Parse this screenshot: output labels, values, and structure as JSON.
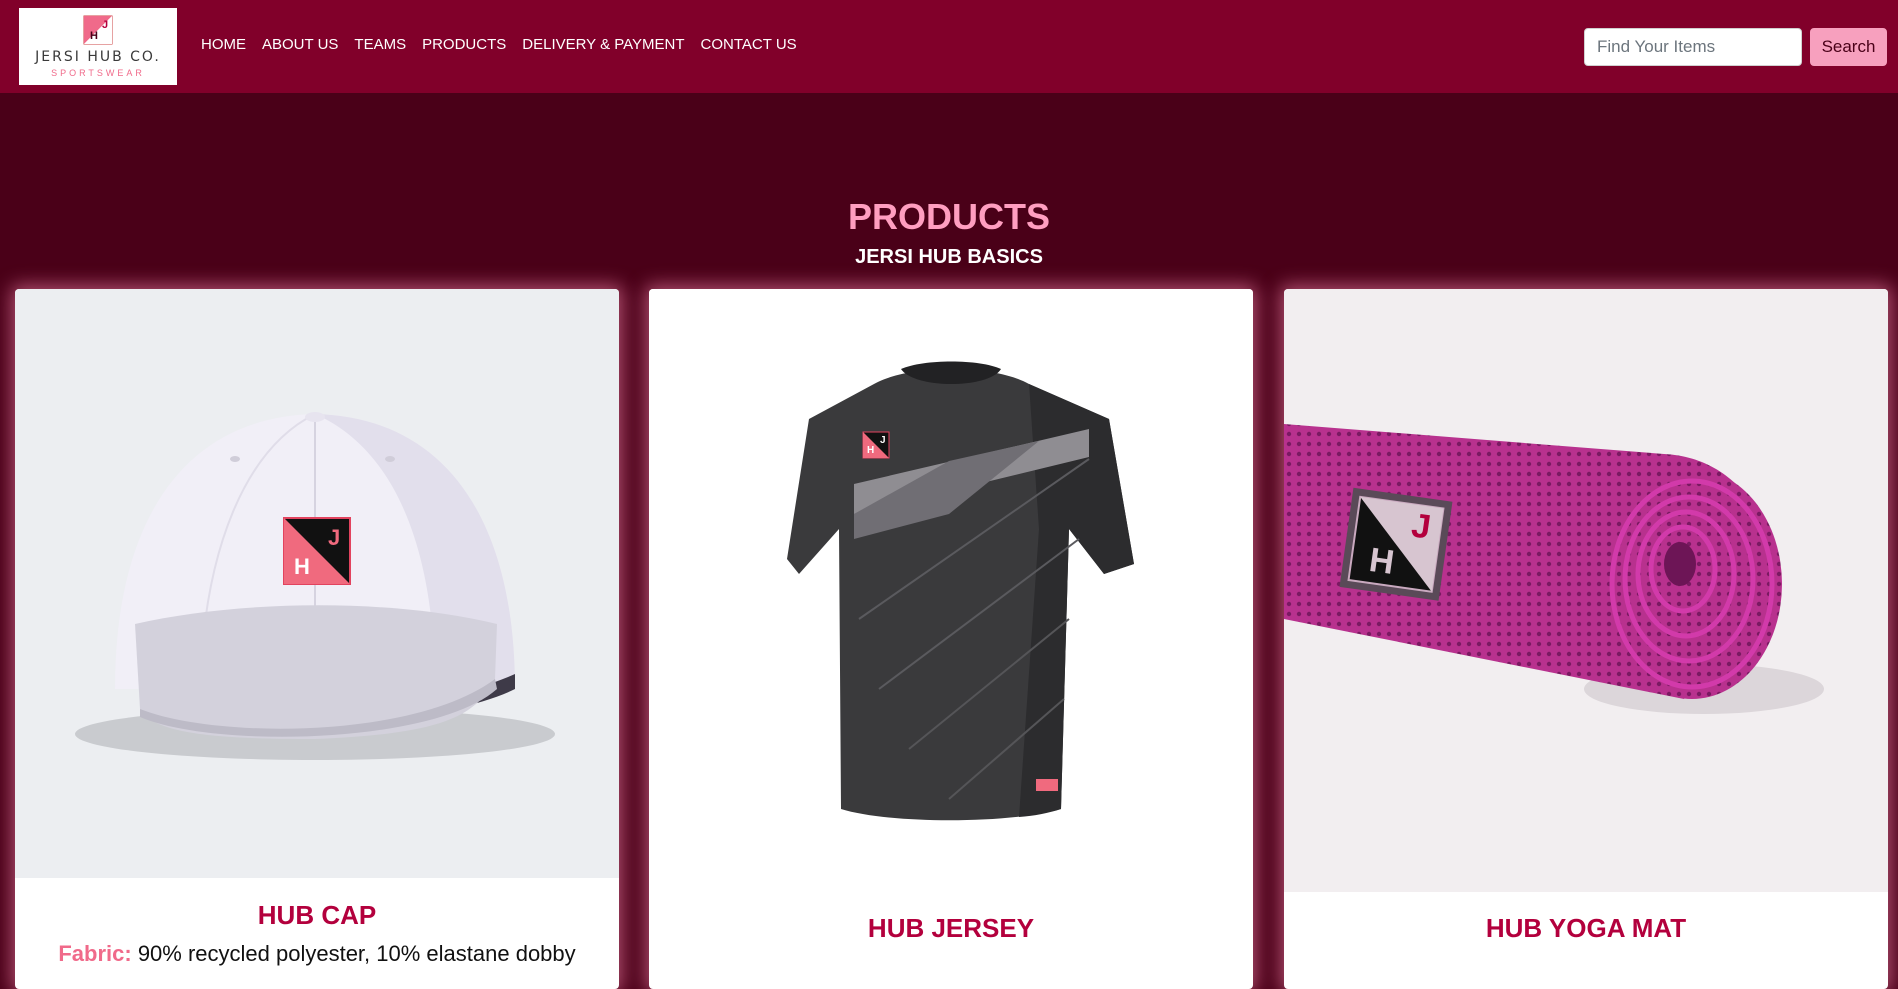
{
  "navbar": {
    "logo": {
      "name": "JERSI HUB CO.",
      "tagline": "SPORTSWEAR"
    },
    "links": [
      "HOME",
      "ABOUT US",
      "TEAMS",
      "PRODUCTS",
      "DELIVERY & PAYMENT",
      "CONTACT US"
    ],
    "search": {
      "placeholder": "Find Your Items",
      "button_label": "Search"
    }
  },
  "section": {
    "title": "PRODUCTS",
    "subtitle": "JERSI HUB BASICS"
  },
  "products": [
    {
      "title": "HUB CAP",
      "desc_label": "Fabric:",
      "desc_text": " 90% recycled polyester, 10% elastane dobby"
    },
    {
      "title": "HUB JERSEY"
    },
    {
      "title": "HUB YOGA MAT"
    }
  ],
  "colors": {
    "navbar": "#81002a",
    "page_bg": "#4a0018",
    "heading": "#ff9ec0",
    "product_title": "#b3003d",
    "search_button": "#f7a0be",
    "logo_accent": "#f06a8a",
    "yoga_mat": "#c0379a"
  }
}
